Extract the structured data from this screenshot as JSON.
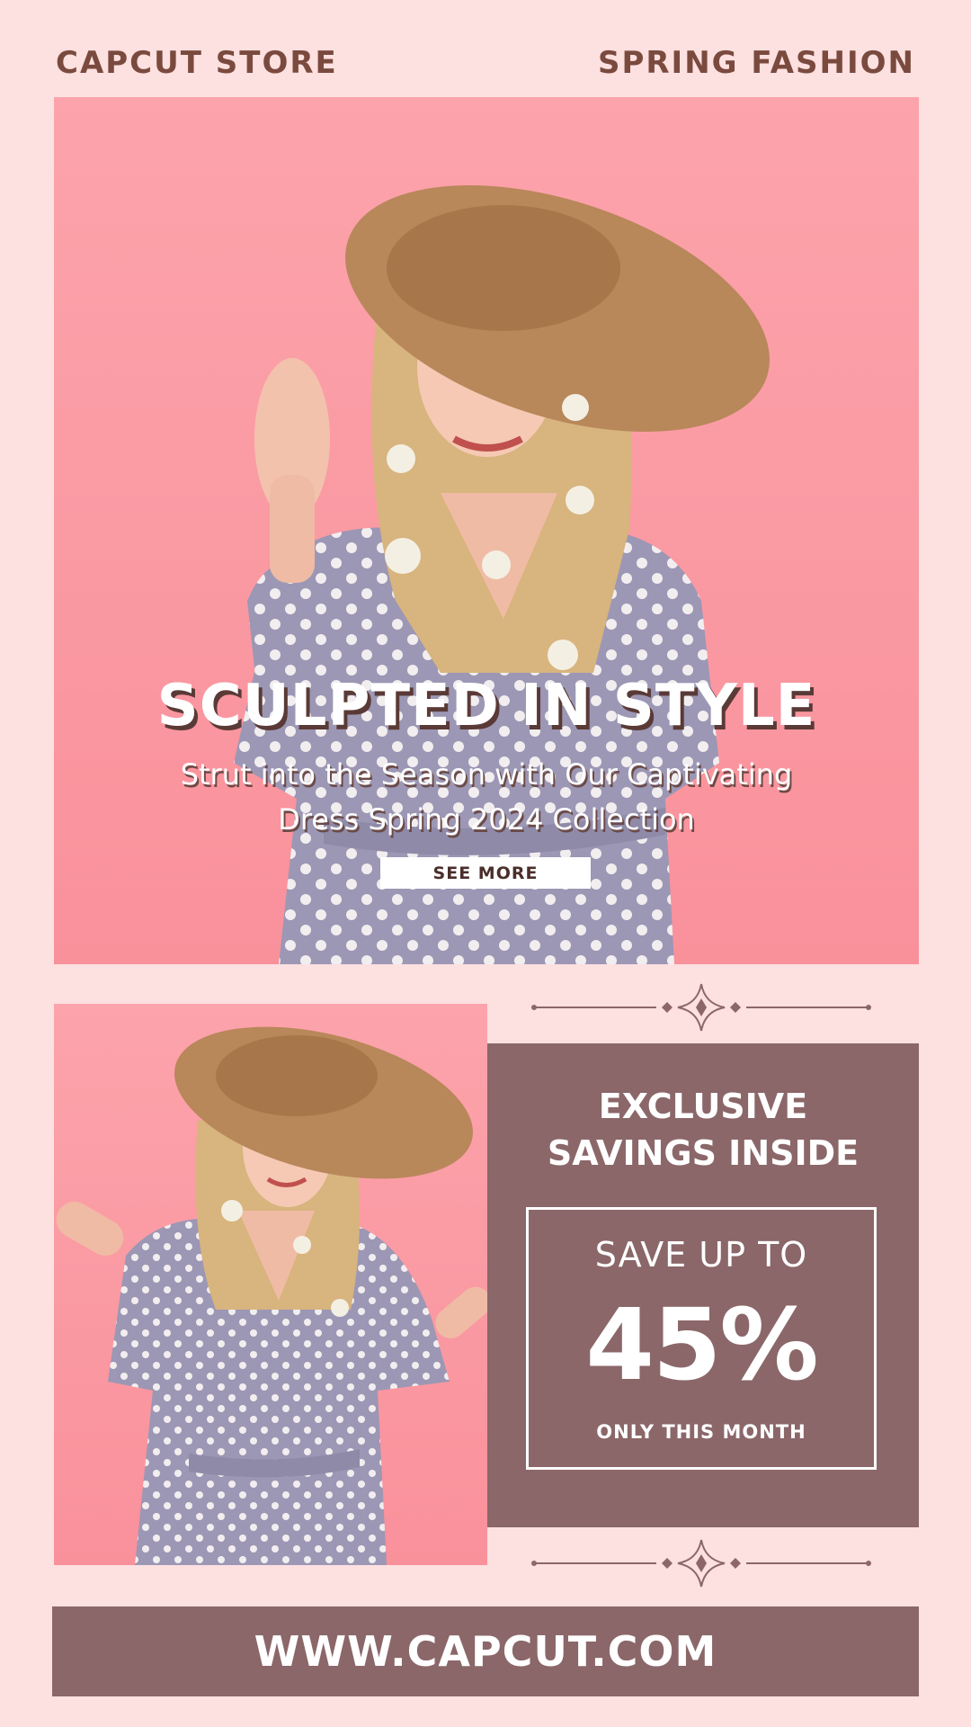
{
  "header": {
    "store_name": "CAPCUT STORE",
    "season": "SPRING FASHION"
  },
  "hero": {
    "headline": "SCULPTED IN STYLE",
    "subline_1": "Strut into the Season with Our Captivating",
    "subline_2": "Dress Spring 2024 Collection",
    "cta_label": "SEE MORE"
  },
  "promo": {
    "title_1": "EXCLUSIVE",
    "title_2": "SAVINGS INSIDE",
    "save_label": "SAVE UP TO",
    "save_value": "45%",
    "save_note": "ONLY THIS MONTH"
  },
  "footer": {
    "url": "WWW.CAPCUT.COM"
  },
  "colors": {
    "background": "#fde0e0",
    "photo_bg": "#fca3ab",
    "accent": "#8b6769",
    "header_text": "#7a4a3e",
    "dress": "#9c97b4",
    "hat": "#b8875a",
    "hair": "#d8b47e"
  },
  "icons": [
    "sparkle-ornament-icon"
  ]
}
